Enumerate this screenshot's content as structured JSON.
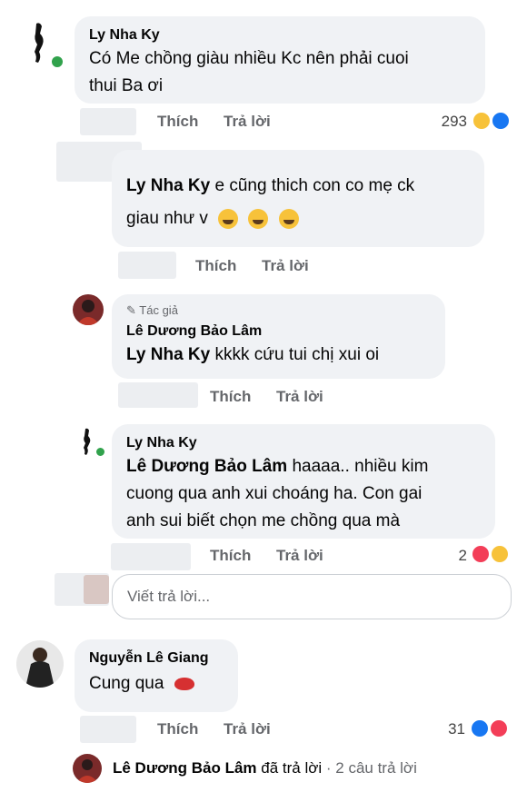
{
  "comments": {
    "c1": {
      "author": "Ly Nha Ky",
      "text_line1": "Có Me chồng giàu nhiều Kc nên phải cuoi",
      "text_line2": "thui Ba ơi",
      "like": "Thích",
      "reply": "Trả lời",
      "count": "293"
    },
    "c2": {
      "mention": "Ly Nha Ky",
      "text_line1": " e cũng thich con co mẹ ck",
      "text_line2": "giau như v",
      "like": "Thích",
      "reply": "Trả lời"
    },
    "c3": {
      "badge": "Tác giả",
      "author": "Lê Dương Bảo Lâm",
      "mention": "Ly Nha Ky",
      "text": "  kkkk cứu tui chị xui oi",
      "like": "Thích",
      "reply": "Trả lời"
    },
    "c4": {
      "author": "Ly Nha Ky",
      "mention": "Lê Dương Bảo Lâm",
      "text_line1": " haaaa.. nhiều kim",
      "text_line2": "cuong qua anh xui choáng ha. Con gai",
      "text_line3": "anh sui biết chọn me chồng qua mà",
      "like": "Thích",
      "reply": "Trả lời",
      "count": "2"
    },
    "c5": {
      "author": "Nguyễn Lê Giang",
      "text": "Cung qua",
      "like": "Thích",
      "reply": "Trả lời",
      "count": "31"
    }
  },
  "reply_box": {
    "placeholder": "Viết trả lời..."
  },
  "footer": {
    "author": "Lê Dương Bảo Lâm",
    "action": " đã trả lời",
    "separator": " · ",
    "replies": "2 câu trả lời"
  },
  "colors": {
    "bubble": "#f0f2f5",
    "secondary_text": "#65676b",
    "like_blue": "#1877f2",
    "haha_yellow": "#f7c23a",
    "love_red": "#f33e58",
    "online_green": "#31a24c"
  }
}
